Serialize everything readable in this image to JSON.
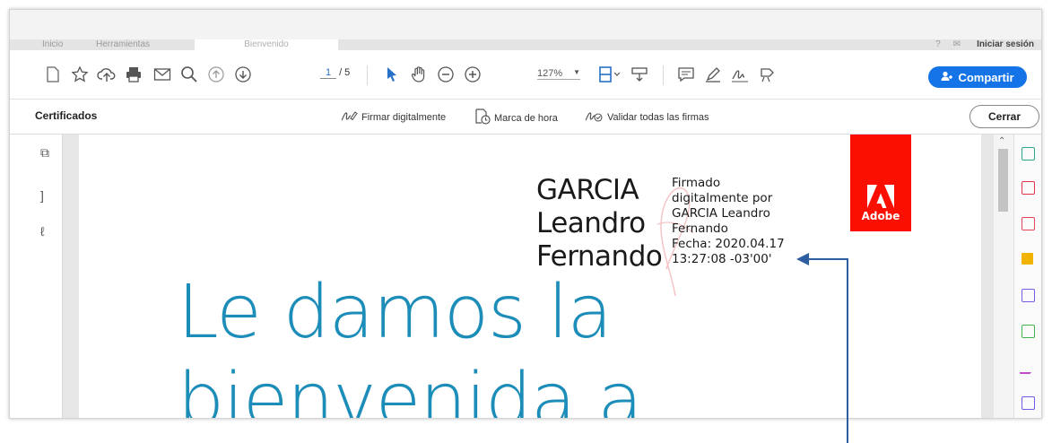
{
  "tabs": {
    "home": "Inicio",
    "tools": "Herramientas",
    "document": "Bienvenido",
    "signin": "Iniciar sesión"
  },
  "toolbar": {
    "page_current": "1",
    "page_total": "/ 5",
    "zoom": "127%",
    "share_label": "Compartir"
  },
  "certbar": {
    "title": "Certificados",
    "sign_digitally": "Firmar digitalmente",
    "timestamp": "Marca de hora",
    "validate_all": "Validar todas las firmas",
    "close": "Cerrar"
  },
  "document": {
    "logo_word": "Adobe",
    "signer_lines": [
      "GARCIA",
      "Leandro",
      "Fernando"
    ],
    "signature_details": [
      "Firmado",
      "digitalmente por",
      "GARCIA Leandro",
      "Fernando",
      "Fecha: 2020.04.17",
      "13:27:08 -03'00'"
    ],
    "welcome_lines": [
      "Le damos la",
      "bienvenida a"
    ]
  },
  "colors": {
    "accent": "#1473e6",
    "adobe_red": "#fa0f00",
    "welcome_text": "#1c8db8",
    "annotation": "#2e5ea0"
  }
}
